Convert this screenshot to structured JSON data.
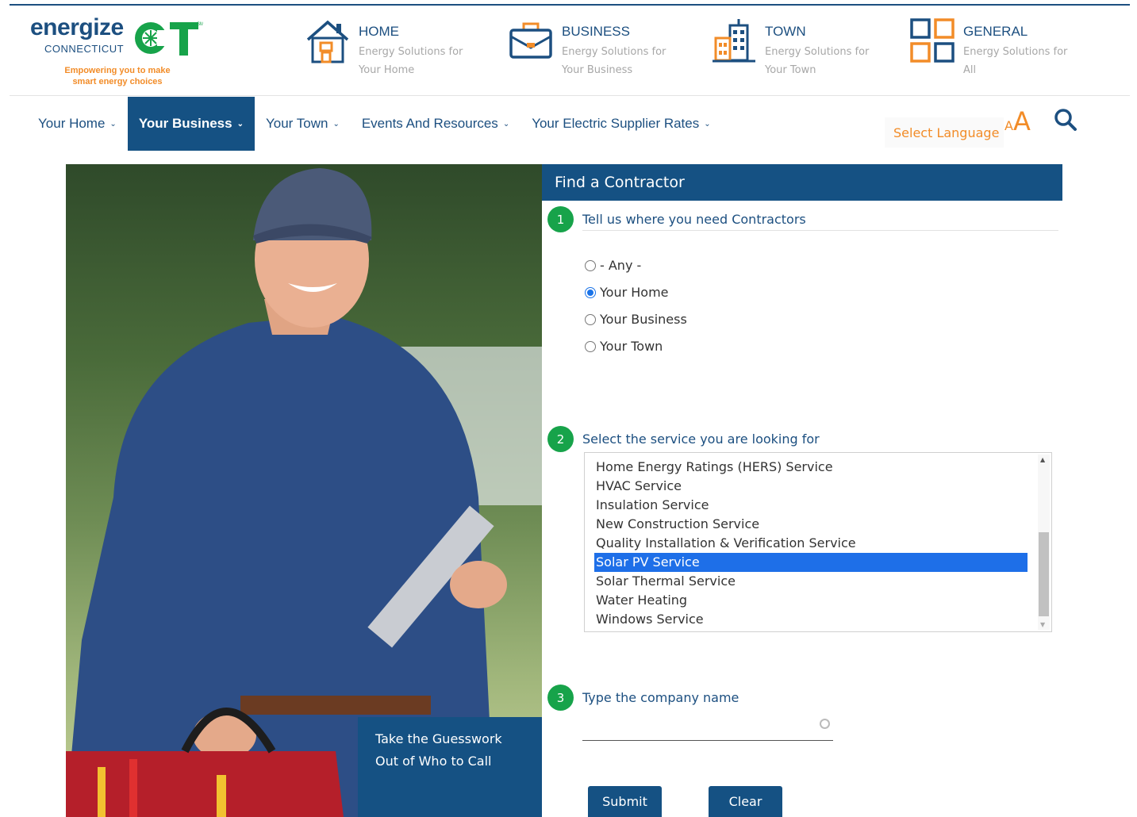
{
  "logo": {
    "word": "energize",
    "connecticut": "CONNECTICUT",
    "ct": "CT",
    "sm": "SM",
    "tagline_1": "Empowering you to make",
    "tagline_2": "smart energy choices"
  },
  "audiences": [
    {
      "title": "HOME",
      "sub1": "Energy Solutions for",
      "sub2": "Your Home"
    },
    {
      "title": "BUSINESS",
      "sub1": "Energy Solutions for",
      "sub2": "Your Business"
    },
    {
      "title": "TOWN",
      "sub1": "Energy Solutions for",
      "sub2": "Your Town"
    },
    {
      "title": "GENERAL",
      "sub1": "Energy Solutions for",
      "sub2": "All"
    }
  ],
  "nav": [
    {
      "label": "Your Home"
    },
    {
      "label": "Your Business"
    },
    {
      "label": "Your Town"
    },
    {
      "label": "Events And Resources"
    },
    {
      "label": "Your Electric Supplier Rates"
    }
  ],
  "nav_chevron": "⌄",
  "utility": {
    "select_language": "Select Language",
    "aa_small": "A",
    "aa_big": "A"
  },
  "hero": {
    "line1": "Take the Guesswork",
    "line2": "Out of Who to Call"
  },
  "form": {
    "title": "Find a Contractor",
    "step1": {
      "num": "1",
      "label": "Tell us where you need Contractors"
    },
    "radios": [
      {
        "label": "- Any -",
        "checked": false
      },
      {
        "label": "Your Home",
        "checked": true
      },
      {
        "label": "Your Business",
        "checked": false
      },
      {
        "label": "Your Town",
        "checked": false
      }
    ],
    "step2": {
      "num": "2",
      "label": "Select the service you are looking for"
    },
    "services": [
      "Home Energy Ratings (HERS) Service",
      "HVAC Service",
      "Insulation Service",
      "New Construction Service",
      "Quality Installation & Verification Service",
      "Solar PV Service",
      "Solar Thermal Service",
      "Water Heating",
      "Windows Service"
    ],
    "selected_service": "Solar PV Service",
    "step3": {
      "num": "3",
      "label": "Type the company name"
    },
    "company_value": "",
    "submit_label": "Submit",
    "clear_label": "Clear"
  },
  "colors": {
    "brand_blue": "#155183",
    "accent_orange": "#f28c28",
    "step_green": "#17a34a",
    "selection_blue": "#1e6fe8"
  }
}
